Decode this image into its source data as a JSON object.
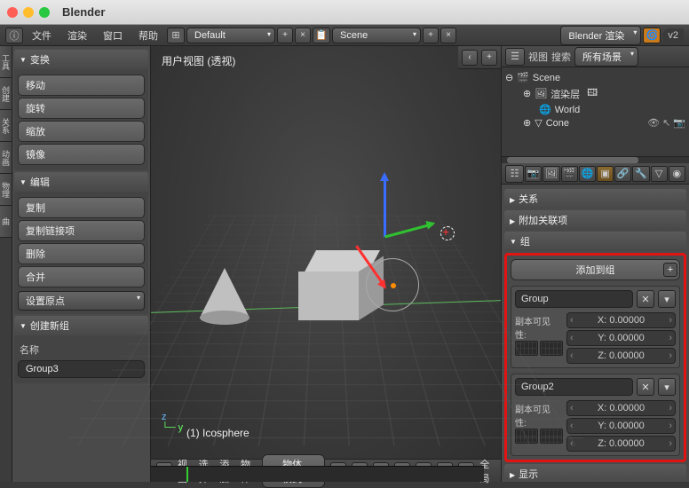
{
  "app": {
    "title": "Blender"
  },
  "menubar": {
    "items": [
      "文件",
      "渲染",
      "窗口",
      "帮助"
    ],
    "layout_dropdown": "Default",
    "scene_dropdown": "Scene",
    "engine_dropdown": "Blender 渲染",
    "version": "v2"
  },
  "left": {
    "transform": {
      "header": "变换",
      "buttons": [
        "移动",
        "旋转",
        "缩放",
        "镜像"
      ]
    },
    "edit": {
      "header": "编辑",
      "buttons": [
        "复制",
        "复制链接项",
        "删除",
        "合并"
      ],
      "set_origin": "设置原点"
    },
    "create_group": {
      "header": "创建新组",
      "name_label": "名称",
      "name_value": "Group3"
    }
  },
  "viewport": {
    "label": "用户视图 (透视)",
    "overlay_text": "(1) Icosphere",
    "footer": {
      "menus": [
        "视图",
        "选择",
        "添加",
        "物体"
      ],
      "mode": "物体模式",
      "global_local": "全局"
    }
  },
  "outliner": {
    "header": {
      "view": "视图",
      "search_label": "搜索",
      "filter": "所有场景"
    },
    "tree": {
      "root": "Scene",
      "children": [
        "渲染层",
        "World",
        "Cone"
      ],
      "render_layer_icon": "🖽"
    }
  },
  "properties": {
    "panels": {
      "relations": "关系",
      "extra_relations": "附加关联项",
      "group": "组",
      "display": "显示"
    },
    "group": {
      "add_button": "添加到组",
      "entries": [
        {
          "name": "Group",
          "dupli_label": "副本可见性:",
          "x": "X: 0.00000",
          "y": "Y: 0.00000",
          "z": "Z: 0.00000"
        },
        {
          "name": "Group2",
          "dupli_label": "副本可见性:",
          "x": "X: 0.00000",
          "y": "Y: 0.00000",
          "z": "Z: 0.00000"
        }
      ]
    }
  },
  "vtabs": [
    "工具",
    "创建",
    "关系",
    "动画",
    "物理",
    "曲"
  ]
}
